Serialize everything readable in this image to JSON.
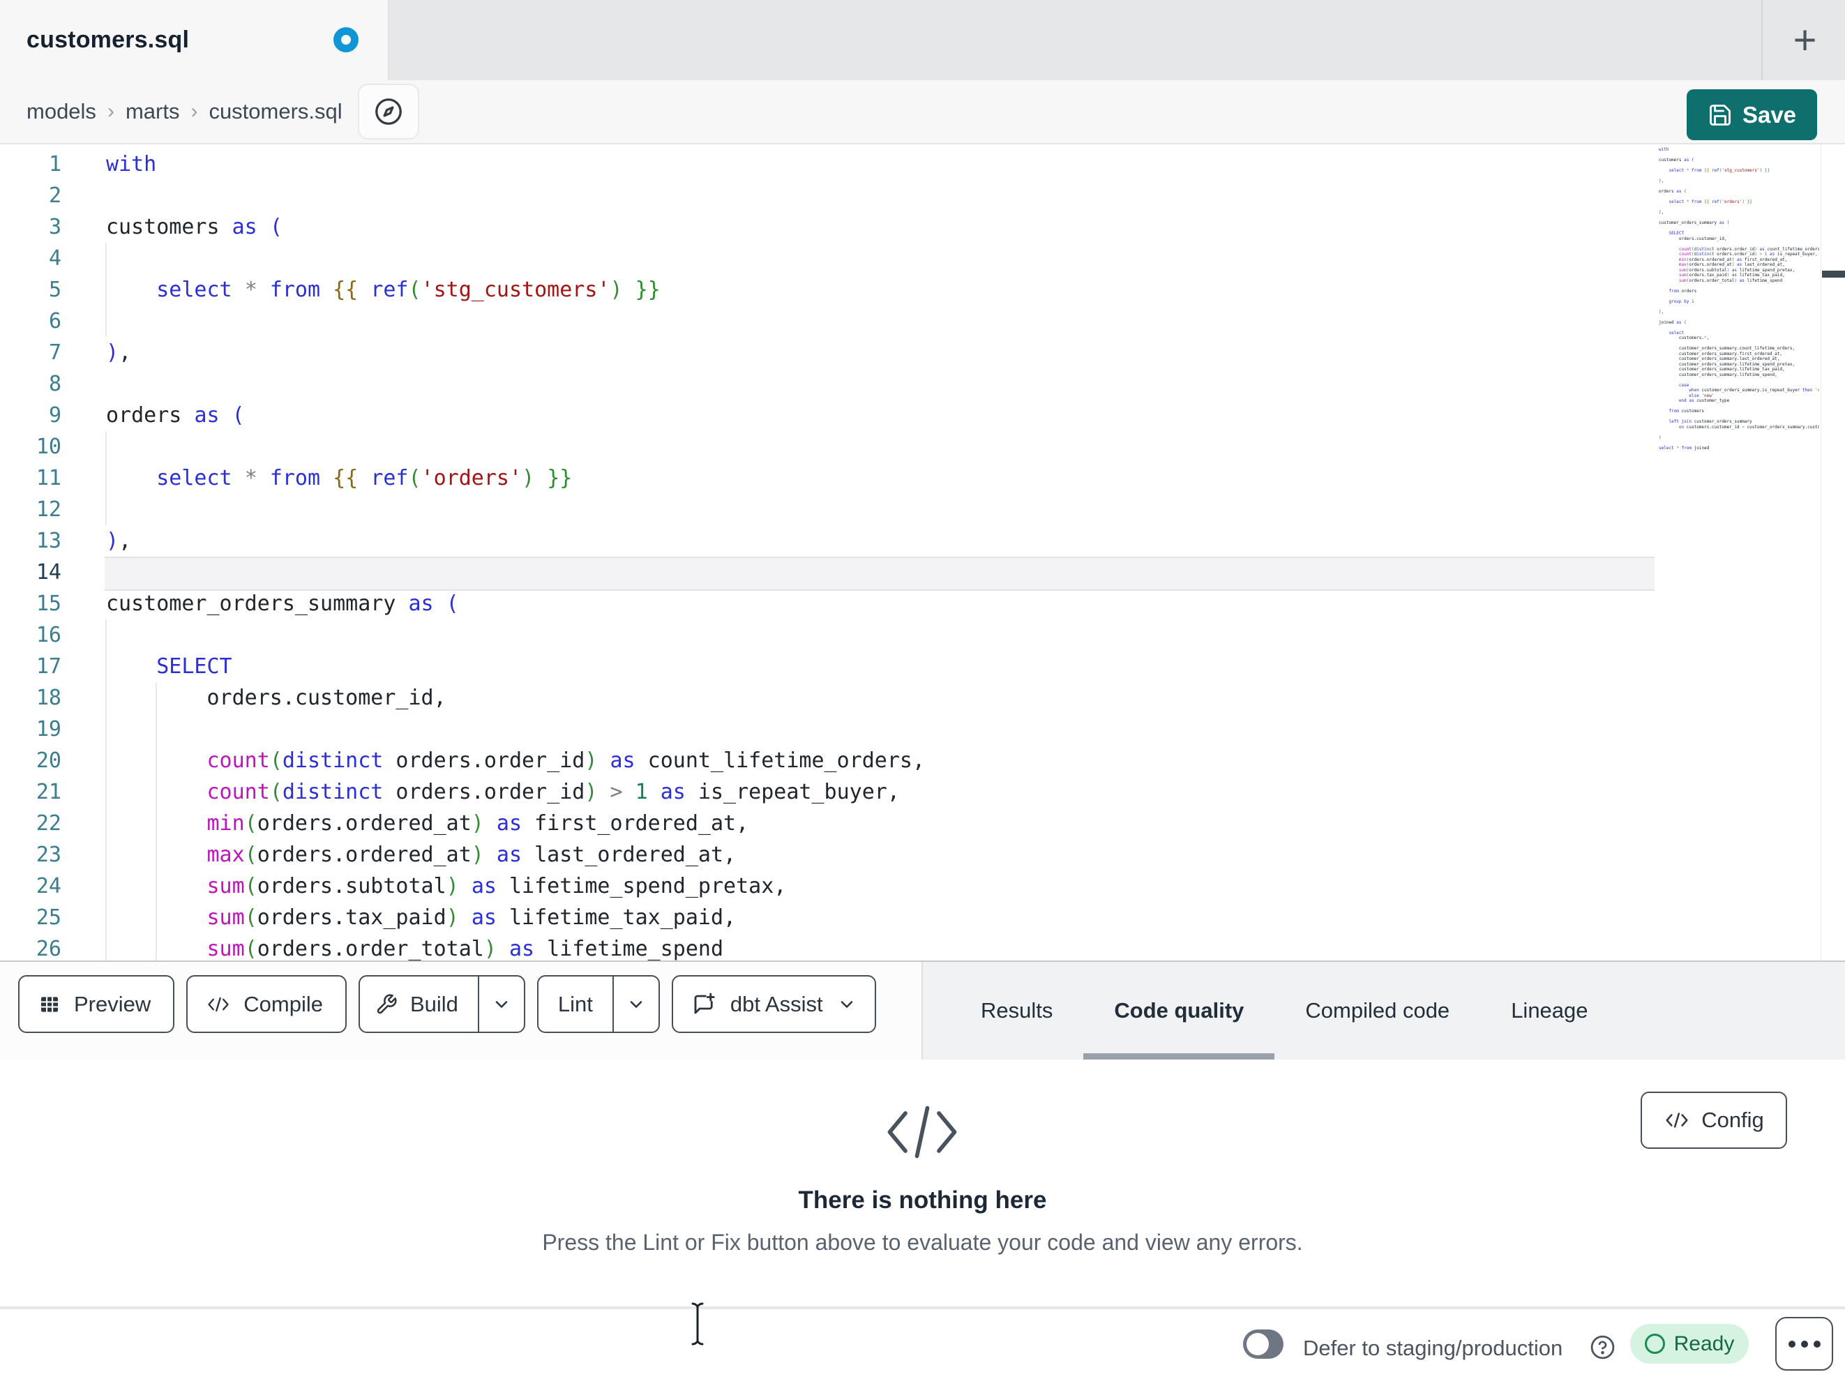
{
  "tab": {
    "title": "customers.sql",
    "unsaved": true,
    "new_tab_label": "+"
  },
  "breadcrumb": {
    "items": [
      "models",
      "marts",
      "customers.sql"
    ],
    "separator": "›"
  },
  "save": {
    "label": "Save",
    "icon": "floppy-icon"
  },
  "colors": {
    "accent_teal": "#0e6f6c",
    "unsaved_blue": "#1095d6",
    "ready_bg": "#d6f3e1",
    "ready_text": "#15693f",
    "syntax": {
      "keyword": "#2b2fd6",
      "function": "#bc16bc",
      "paren_outer": "#2b2fd6",
      "paren_inner": "#368c36",
      "string": "#a31515",
      "number": "#0e8060",
      "operator": "#7a8087",
      "text": "#20262c",
      "jinja_open": "#8a6914",
      "jinja_close": "#2e8b2e"
    }
  },
  "editor": {
    "active_line": 14,
    "visible_lines": 26,
    "file_lines": [
      [
        [
          "kw",
          "with"
        ]
      ],
      [],
      [
        [
          "txt",
          "customers "
        ],
        [
          "kw",
          "as"
        ],
        [
          "txt",
          " "
        ],
        [
          "p1",
          "("
        ]
      ],
      [],
      [
        [
          "txt",
          "    "
        ],
        [
          "kw",
          "select"
        ],
        [
          "txt",
          " "
        ],
        [
          "op",
          "*"
        ],
        [
          "txt",
          " "
        ],
        [
          "kw",
          "from"
        ],
        [
          "txt",
          " "
        ],
        [
          "jo",
          "{{"
        ],
        [
          "txt",
          " "
        ],
        [
          "kw",
          "ref"
        ],
        [
          "p2",
          "("
        ],
        [
          "str",
          "'stg_customers'"
        ],
        [
          "p2",
          ")"
        ],
        [
          "txt",
          " "
        ],
        [
          "jc",
          "}}"
        ]
      ],
      [],
      [
        [
          "p1",
          ")"
        ],
        [
          "txt",
          ","
        ]
      ],
      [],
      [
        [
          "txt",
          "orders "
        ],
        [
          "kw",
          "as"
        ],
        [
          "txt",
          " "
        ],
        [
          "p1",
          "("
        ]
      ],
      [],
      [
        [
          "txt",
          "    "
        ],
        [
          "kw",
          "select"
        ],
        [
          "txt",
          " "
        ],
        [
          "op",
          "*"
        ],
        [
          "txt",
          " "
        ],
        [
          "kw",
          "from"
        ],
        [
          "txt",
          " "
        ],
        [
          "jo",
          "{{"
        ],
        [
          "txt",
          " "
        ],
        [
          "kw",
          "ref"
        ],
        [
          "p2",
          "("
        ],
        [
          "str",
          "'orders'"
        ],
        [
          "p2",
          ")"
        ],
        [
          "txt",
          " "
        ],
        [
          "jc",
          "}}"
        ]
      ],
      [],
      [
        [
          "p1",
          ")"
        ],
        [
          "txt",
          ","
        ]
      ],
      [],
      [
        [
          "txt",
          "customer_orders_summary "
        ],
        [
          "kw",
          "as"
        ],
        [
          "txt",
          " "
        ],
        [
          "p1",
          "("
        ]
      ],
      [],
      [
        [
          "txt",
          "    "
        ],
        [
          "kw",
          "SELECT"
        ]
      ],
      [
        [
          "txt",
          "        orders.customer_id,"
        ]
      ],
      [],
      [
        [
          "txt",
          "        "
        ],
        [
          "fn",
          "count"
        ],
        [
          "p2",
          "("
        ],
        [
          "kw",
          "distinct"
        ],
        [
          "txt",
          " orders.order_id"
        ],
        [
          "p2",
          ")"
        ],
        [
          "txt",
          " "
        ],
        [
          "kw",
          "as"
        ],
        [
          "txt",
          " count_lifetime_orders,"
        ]
      ],
      [
        [
          "txt",
          "        "
        ],
        [
          "fn",
          "count"
        ],
        [
          "p2",
          "("
        ],
        [
          "kw",
          "distinct"
        ],
        [
          "txt",
          " orders.order_id"
        ],
        [
          "p2",
          ")"
        ],
        [
          "txt",
          " "
        ],
        [
          "op",
          ">"
        ],
        [
          "txt",
          " "
        ],
        [
          "num",
          "1"
        ],
        [
          "txt",
          " "
        ],
        [
          "kw",
          "as"
        ],
        [
          "txt",
          " is_repeat_buyer,"
        ]
      ],
      [
        [
          "txt",
          "        "
        ],
        [
          "fn",
          "min"
        ],
        [
          "p2",
          "("
        ],
        [
          "txt",
          "orders.ordered_at"
        ],
        [
          "p2",
          ")"
        ],
        [
          "txt",
          " "
        ],
        [
          "kw",
          "as"
        ],
        [
          "txt",
          " first_ordered_at,"
        ]
      ],
      [
        [
          "txt",
          "        "
        ],
        [
          "fn",
          "max"
        ],
        [
          "p2",
          "("
        ],
        [
          "txt",
          "orders.ordered_at"
        ],
        [
          "p2",
          ")"
        ],
        [
          "txt",
          " "
        ],
        [
          "kw",
          "as"
        ],
        [
          "txt",
          " last_ordered_at,"
        ]
      ],
      [
        [
          "txt",
          "        "
        ],
        [
          "fn",
          "sum"
        ],
        [
          "p2",
          "("
        ],
        [
          "txt",
          "orders.subtotal"
        ],
        [
          "p2",
          ")"
        ],
        [
          "txt",
          " "
        ],
        [
          "kw",
          "as"
        ],
        [
          "txt",
          " lifetime_spend_pretax,"
        ]
      ],
      [
        [
          "txt",
          "        "
        ],
        [
          "fn",
          "sum"
        ],
        [
          "p2",
          "("
        ],
        [
          "txt",
          "orders.tax_paid"
        ],
        [
          "p2",
          ")"
        ],
        [
          "txt",
          " "
        ],
        [
          "kw",
          "as"
        ],
        [
          "txt",
          " lifetime_tax_paid,"
        ]
      ],
      [
        [
          "txt",
          "        "
        ],
        [
          "fn",
          "sum"
        ],
        [
          "p2",
          "("
        ],
        [
          "txt",
          "orders.order_total"
        ],
        [
          "p2",
          ")"
        ],
        [
          "txt",
          " "
        ],
        [
          "kw",
          "as"
        ],
        [
          "txt",
          " lifetime_spend"
        ]
      ],
      [],
      [
        [
          "txt",
          "    "
        ],
        [
          "kw",
          "from"
        ],
        [
          "txt",
          " orders"
        ]
      ],
      [],
      [
        [
          "txt",
          "    "
        ],
        [
          "kw",
          "group by"
        ],
        [
          "txt",
          " "
        ],
        [
          "num",
          "1"
        ]
      ],
      [],
      [
        [
          "p1",
          ")"
        ],
        [
          "txt",
          ","
        ]
      ],
      [],
      [
        [
          "txt",
          "joined "
        ],
        [
          "kw",
          "as"
        ],
        [
          "txt",
          " "
        ],
        [
          "p1",
          "("
        ]
      ],
      [],
      [
        [
          "txt",
          "    "
        ],
        [
          "kw",
          "select"
        ]
      ],
      [
        [
          "txt",
          "        customers."
        ],
        [
          "op",
          "*"
        ],
        [
          "txt",
          ","
        ]
      ],
      [],
      [
        [
          "txt",
          "        customer_orders_summary.count_lifetime_orders,"
        ]
      ],
      [
        [
          "txt",
          "        customer_orders_summary.first_ordered_at,"
        ]
      ],
      [
        [
          "txt",
          "        customer_orders_summary.last_ordered_at,"
        ]
      ],
      [
        [
          "txt",
          "        customer_orders_summary.lifetime_spend_pretax,"
        ]
      ],
      [
        [
          "txt",
          "        customer_orders_summary.lifetime_tax_paid,"
        ]
      ],
      [
        [
          "txt",
          "        customer_orders_summary.lifetime_spend,"
        ]
      ],
      [],
      [
        [
          "txt",
          "        "
        ],
        [
          "kw",
          "case"
        ]
      ],
      [
        [
          "txt",
          "            "
        ],
        [
          "kw",
          "when"
        ],
        [
          "txt",
          " customer_orders_summary.is_repeat_buyer "
        ],
        [
          "kw",
          "then"
        ],
        [
          "txt",
          " "
        ],
        [
          "str",
          "'returning'"
        ]
      ],
      [
        [
          "txt",
          "            "
        ],
        [
          "kw",
          "else"
        ],
        [
          "txt",
          " "
        ],
        [
          "str",
          "'new'"
        ]
      ],
      [
        [
          "txt",
          "        "
        ],
        [
          "kw",
          "end"
        ],
        [
          "txt",
          " "
        ],
        [
          "kw",
          "as"
        ],
        [
          "txt",
          " customer_type"
        ]
      ],
      [],
      [
        [
          "txt",
          "    "
        ],
        [
          "kw",
          "from"
        ],
        [
          "txt",
          " customers"
        ]
      ],
      [],
      [
        [
          "txt",
          "    "
        ],
        [
          "kw",
          "left join"
        ],
        [
          "txt",
          " customer_orders_summary"
        ]
      ],
      [
        [
          "txt",
          "        "
        ],
        [
          "kw",
          "on"
        ],
        [
          "txt",
          " customers.customer_id "
        ],
        [
          "op",
          "="
        ],
        [
          "txt",
          " customer_orders_summary.customer_id"
        ]
      ],
      [],
      [
        [
          "p1",
          ")"
        ]
      ],
      [],
      [
        [
          "kw",
          "select"
        ],
        [
          "txt",
          " "
        ],
        [
          "op",
          "*"
        ],
        [
          "txt",
          " "
        ],
        [
          "kw",
          "from"
        ],
        [
          "txt",
          " joined"
        ]
      ]
    ]
  },
  "toolbar": {
    "preview_label": "Preview",
    "preview_icon": "table-icon",
    "compile_label": "Compile",
    "compile_icon": "code-icon",
    "build_label": "Build",
    "build_icon": "wrench-icon",
    "lint_label": "Lint",
    "assist_label": "dbt Assist",
    "assist_icon": "chat-sparkle-icon"
  },
  "panel_tabs": {
    "items": [
      {
        "label": "Results"
      },
      {
        "label": "Code quality"
      },
      {
        "label": "Compiled code"
      },
      {
        "label": "Lineage"
      }
    ],
    "active_index": 1
  },
  "results": {
    "empty_icon": "code-icon",
    "empty_title": "There is nothing here",
    "empty_hint": "Press the Lint or Fix button above to evaluate your code and view any errors.",
    "config_label": "Config"
  },
  "statusbar": {
    "defer_label": "Defer to staging/production",
    "defer_toggle_on": false,
    "ready_label": "Ready"
  }
}
